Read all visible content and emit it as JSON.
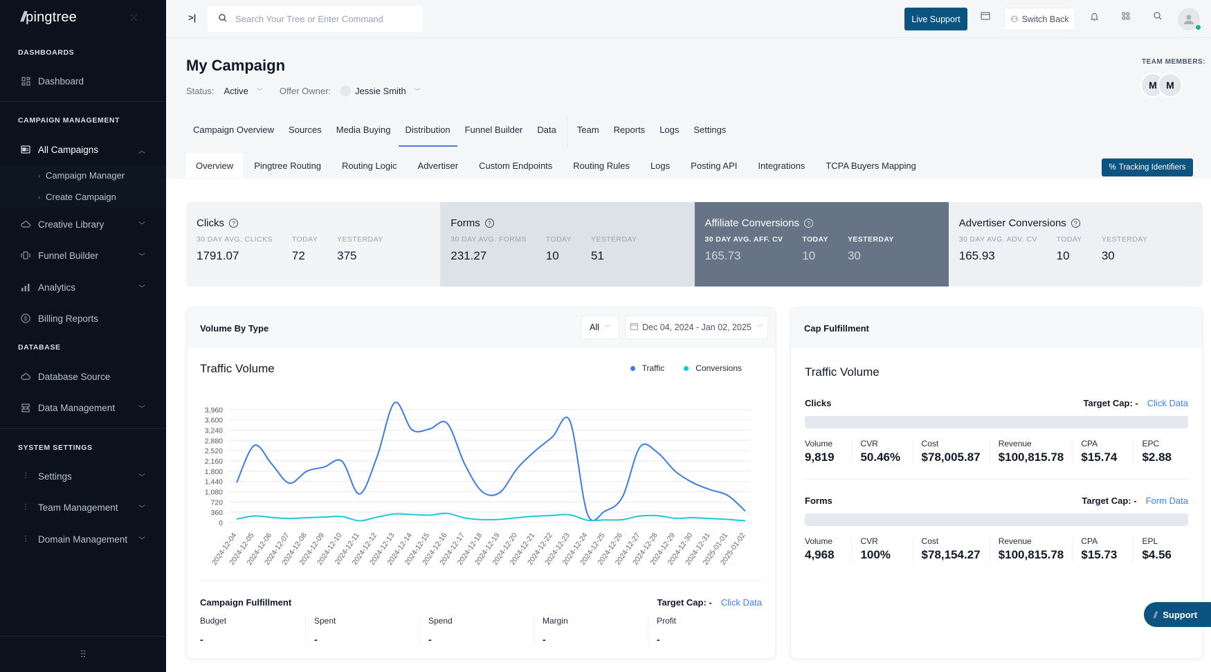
{
  "brand": {
    "name": "pingtree",
    "accent": "#0b5482",
    "link": "#3b82f6"
  },
  "sidebar": {
    "sections": [
      {
        "heading": "DASHBOARDS"
      },
      {
        "heading": "CAMPAIGN MANAGEMENT"
      },
      {
        "heading": "DATABASE"
      },
      {
        "heading": "SYSTEM SETTINGS"
      }
    ],
    "items": [
      {
        "label": "Dashboard",
        "icon": "grid-icon"
      },
      {
        "label": "All Campaigns",
        "icon": "campaign-card-icon",
        "expanded": true
      },
      {
        "label": "Creative Library",
        "icon": "cloud-icon"
      },
      {
        "label": "Funnel Builder",
        "icon": "funnel-icon"
      },
      {
        "label": "Analytics",
        "icon": "bar-chart-icon"
      },
      {
        "label": "Billing Reports",
        "icon": "dollar-circle-icon"
      },
      {
        "label": "Database Source",
        "icon": "cloud-icon"
      },
      {
        "label": "Data Management",
        "icon": "database-icon"
      },
      {
        "label": "Settings",
        "icon": "sliders-icon"
      },
      {
        "label": "Team Management",
        "icon": "sliders-icon"
      },
      {
        "label": "Domain Management",
        "icon": "sliders-icon"
      }
    ],
    "subitems": [
      {
        "label": "Campaign Manager"
      },
      {
        "label": "Create Campaign"
      }
    ]
  },
  "topbar": {
    "search_placeholder": "Search Your Tree or Enter Command",
    "live_support": "Live Support",
    "switch_back": "Switch Back"
  },
  "page": {
    "title": "My Campaign",
    "status_label": "Status:",
    "status_value": "Active",
    "owner_label": "Offer Owner:",
    "owner_value": "Jessie Smith",
    "team_label": "TEAM MEMBERS:",
    "team_members": [
      "M",
      "M"
    ]
  },
  "tabs": {
    "main": [
      "Campaign Overview",
      "Sources",
      "Media Buying",
      "Distribution",
      "Funnel Builder",
      "Data",
      "Team",
      "Reports",
      "Logs",
      "Settings"
    ],
    "main_active": "Distribution",
    "sub": [
      "Overview",
      "Pingtree Routing",
      "Routing Logic",
      "Advertiser",
      "Custom Endpoints",
      "Routing Rules",
      "Logs",
      "Posting API",
      "Integrations",
      "TCPA Buyers Mapping"
    ],
    "sub_active": "Overview",
    "tracking_button": "Tracking Identifiers"
  },
  "stats": [
    {
      "title": "Clicks",
      "cols": [
        {
          "label": "30 DAY AVG. CLICKS",
          "value": "1791.07"
        },
        {
          "label": "TODAY",
          "value": "72"
        },
        {
          "label": "YESTERDAY",
          "value": "375"
        }
      ]
    },
    {
      "title": "Forms",
      "cols": [
        {
          "label": "30 DAY AVG. FORMS",
          "value": "231.27"
        },
        {
          "label": "TODAY",
          "value": "10"
        },
        {
          "label": "YESTERDAY",
          "value": "51"
        }
      ]
    },
    {
      "title": "Affiliate Conversions",
      "cols": [
        {
          "label": "30 DAY AVG. AFF. CV",
          "value": "165.73"
        },
        {
          "label": "TODAY",
          "value": "10"
        },
        {
          "label": "YESTERDAY",
          "value": "30"
        }
      ]
    },
    {
      "title": "Advertiser Conversions",
      "cols": [
        {
          "label": "30 DAY AVG. ADV. CV",
          "value": "165.93"
        },
        {
          "label": "TODAY",
          "value": "10"
        },
        {
          "label": "YESTERDAY",
          "value": "30"
        }
      ]
    }
  ],
  "volume": {
    "header": "Volume By Type",
    "filter": "All",
    "date_range": "Dec 04, 2024 - Jan 02, 2025"
  },
  "chart_data": {
    "type": "line",
    "title": "Traffic Volume",
    "xlabel": "",
    "ylabel": "",
    "ylim": [
      0,
      3960
    ],
    "yticks": [
      0,
      360,
      720,
      1080,
      1440,
      1800,
      2160,
      2520,
      2880,
      3240,
      3600,
      3960
    ],
    "grid": true,
    "legend_position": "top-right",
    "x": [
      "2024-12-04",
      "2024-12-05",
      "2024-12-06",
      "2024-12-07",
      "2024-12-08",
      "2024-12-09",
      "2024-12-10",
      "2024-12-11",
      "2024-12-12",
      "2024-12-13",
      "2024-12-14",
      "2024-12-15",
      "2024-12-16",
      "2024-12-17",
      "2024-12-18",
      "2024-12-19",
      "2024-12-20",
      "2024-12-21",
      "2024-12-22",
      "2024-12-23",
      "2024-12-24",
      "2024-12-25",
      "2024-12-26",
      "2024-12-27",
      "2024-12-28",
      "2024-12-29",
      "2024-12-30",
      "2024-12-31",
      "2025-01-01",
      "2025-01-02"
    ],
    "series": [
      {
        "name": "Traffic",
        "color": "#3b7be8",
        "values": [
          1400,
          2700,
          2050,
          1380,
          1800,
          1950,
          2150,
          1000,
          2300,
          4200,
          3250,
          3280,
          3480,
          2050,
          1080,
          1050,
          1900,
          2500,
          3000,
          3560,
          300,
          400,
          900,
          2650,
          2450,
          1800,
          1400,
          1150,
          950,
          400
        ]
      },
      {
        "name": "Conversions",
        "color": "#1cc8d6",
        "values": [
          120,
          230,
          180,
          140,
          170,
          190,
          210,
          60,
          190,
          300,
          280,
          260,
          320,
          160,
          100,
          110,
          170,
          220,
          250,
          270,
          80,
          90,
          100,
          230,
          240,
          150,
          170,
          140,
          110,
          60
        ]
      }
    ]
  },
  "campaign_fulfillment": {
    "title": "Campaign Fulfillment",
    "target_cap_label": "Target Cap: -",
    "link": "Click Data",
    "cols": [
      {
        "label": "Budget",
        "value": "-"
      },
      {
        "label": "Spent",
        "value": "-"
      },
      {
        "label": "Spend",
        "value": "-"
      },
      {
        "label": "Margin",
        "value": "-"
      },
      {
        "label": "Profit",
        "value": "-"
      }
    ]
  },
  "cap_fulfillment": {
    "header": "Cap Fulfillment",
    "title": "Traffic Volume",
    "sections": [
      {
        "name": "Clicks",
        "target_cap_label": "Target Cap: -",
        "link": "Click Data",
        "progress": 0,
        "metrics": [
          {
            "label": "Volume",
            "value": "9,819"
          },
          {
            "label": "CVR",
            "value": "50.46%"
          },
          {
            "label": "Cost",
            "value": "$78,005.87"
          },
          {
            "label": "Revenue",
            "value": "$100,815.78"
          },
          {
            "label": "CPA",
            "value": "$15.74"
          },
          {
            "label": "EPC",
            "value": "$2.88"
          }
        ]
      },
      {
        "name": "Forms",
        "target_cap_label": "Target Cap: -",
        "link": "Form Data",
        "progress": 0,
        "metrics": [
          {
            "label": "Volume",
            "value": "4,968"
          },
          {
            "label": "CVR",
            "value": "100%"
          },
          {
            "label": "Cost",
            "value": "$78,154.27"
          },
          {
            "label": "Revenue",
            "value": "$100,815.78"
          },
          {
            "label": "CPA",
            "value": "$15.73"
          },
          {
            "label": "EPL",
            "value": "$4.56"
          }
        ]
      }
    ]
  },
  "support_button": "Support"
}
